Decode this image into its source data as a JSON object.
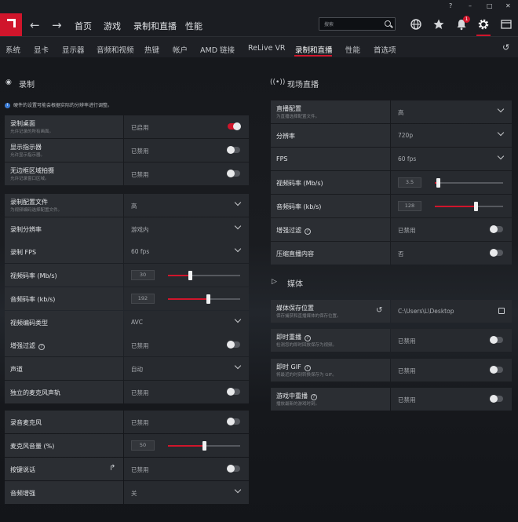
{
  "window": {
    "minimize": "–",
    "maximize": "□",
    "close": "✕",
    "help": "?"
  },
  "nav": {
    "back": "←",
    "forward": "→",
    "items": [
      "首页",
      "游戏",
      "录制和直播",
      "性能"
    ]
  },
  "search": {
    "placeholder": "搜索"
  },
  "icons": {
    "web": "globe-icon",
    "favorites": "star-icon",
    "notifications": "bell-icon",
    "settings": "gear-icon",
    "layout": "window-layout-icon"
  },
  "notifications_count": "1",
  "tabs": [
    "系统",
    "显卡",
    "显示器",
    "音频和视频",
    "热键",
    "帐户",
    "AMD 链接",
    "ReLive VR",
    "录制和直播",
    "性能",
    "首选项"
  ],
  "active_tab": "录制和直播",
  "accent": "#d0152b",
  "recording": {
    "title": "录制",
    "info": "硬件的设置可能会根据实际的分辨率进行调整。",
    "rows": [
      {
        "label": "录制桌面",
        "sub": "允许记录的所有画面。",
        "value": "已启用",
        "control": "toggle",
        "on": true
      },
      {
        "label": "显示指示器",
        "sub": "允许显示指示器。",
        "value": "已禁用",
        "control": "toggle",
        "on": false
      },
      {
        "label": "无边框区域拍摄",
        "sub": "允许记录窗口区域。",
        "value": "已禁用",
        "control": "toggle",
        "on": false
      },
      {
        "label": "录制配置文件",
        "sub": "为视频编码选择配置文件。",
        "value": "高",
        "control": "dropdown"
      },
      {
        "label": "录制分辨率",
        "value": "游戏内",
        "control": "dropdown"
      },
      {
        "label": "录制 FPS",
        "value": "60 fps",
        "control": "dropdown"
      },
      {
        "label": "视频码率 (Mb/s)",
        "value": "30",
        "control": "slider",
        "level": 0.3
      },
      {
        "label": "音频码率 (kb/s)",
        "value": "192",
        "control": "slider",
        "level": 0.55
      },
      {
        "label": "视频编码类型",
        "value": "AVC",
        "control": "dropdown"
      },
      {
        "label": "增强过滤",
        "value": "已禁用",
        "control": "toggle",
        "on": false,
        "help": true
      },
      {
        "label": "声道",
        "value": "自动",
        "control": "dropdown"
      },
      {
        "label": "独立的麦克风声轨",
        "value": "已禁用",
        "control": "toggle",
        "on": false
      },
      {
        "label": "录音麦克风",
        "value": "已禁用",
        "control": "toggle",
        "on": false
      },
      {
        "label": "麦克风音量 (%)",
        "value": "50",
        "control": "slider",
        "level": 0.5
      },
      {
        "label": "按键说话",
        "value": "已禁用",
        "control": "toggle",
        "on": false,
        "hotkey": "↱"
      },
      {
        "label": "音频增强",
        "value": "关",
        "control": "dropdown"
      }
    ]
  },
  "streaming": {
    "title": "现场直播",
    "rows": [
      {
        "label": "直播配置",
        "sub": "为直播选择配置文件。",
        "value": "高",
        "control": "dropdown"
      },
      {
        "label": "分辨率",
        "value": "720p",
        "control": "dropdown"
      },
      {
        "label": "FPS",
        "value": "60 fps",
        "control": "dropdown"
      },
      {
        "label": "视频码率 (Mb/s)",
        "value": "3.5",
        "control": "slider",
        "level": 0.05
      },
      {
        "label": "音频码率 (kb/s)",
        "value": "128",
        "control": "slider",
        "level": 0.6
      },
      {
        "label": "增强过滤",
        "value": "已禁用",
        "control": "toggle",
        "on": false,
        "help": true
      },
      {
        "label": "压缩直播内容",
        "value": "否",
        "control": "toggle",
        "on": false
      }
    ]
  },
  "media": {
    "title": "媒体",
    "rows": [
      {
        "label": "媒体保存位置",
        "sub": "保存捕获和直播媒体的保存位置。",
        "value": "C:\\Users\\L\\Desktop",
        "control": "folder"
      },
      {
        "label": "即时重播",
        "sub": "检测您的即时回放保存为视频。",
        "value": "已禁用",
        "control": "toggle",
        "on": false,
        "help": true
      },
      {
        "label": "即时 GIF",
        "sub": "将最近的时刻转换保存为 GIF。",
        "value": "已禁用",
        "control": "toggle",
        "on": false,
        "help": true
      },
      {
        "label": "游戏中重播",
        "sub": "播放最新的游戏时刻。",
        "value": "已禁用",
        "control": "toggle",
        "on": false,
        "help": true
      }
    ]
  }
}
